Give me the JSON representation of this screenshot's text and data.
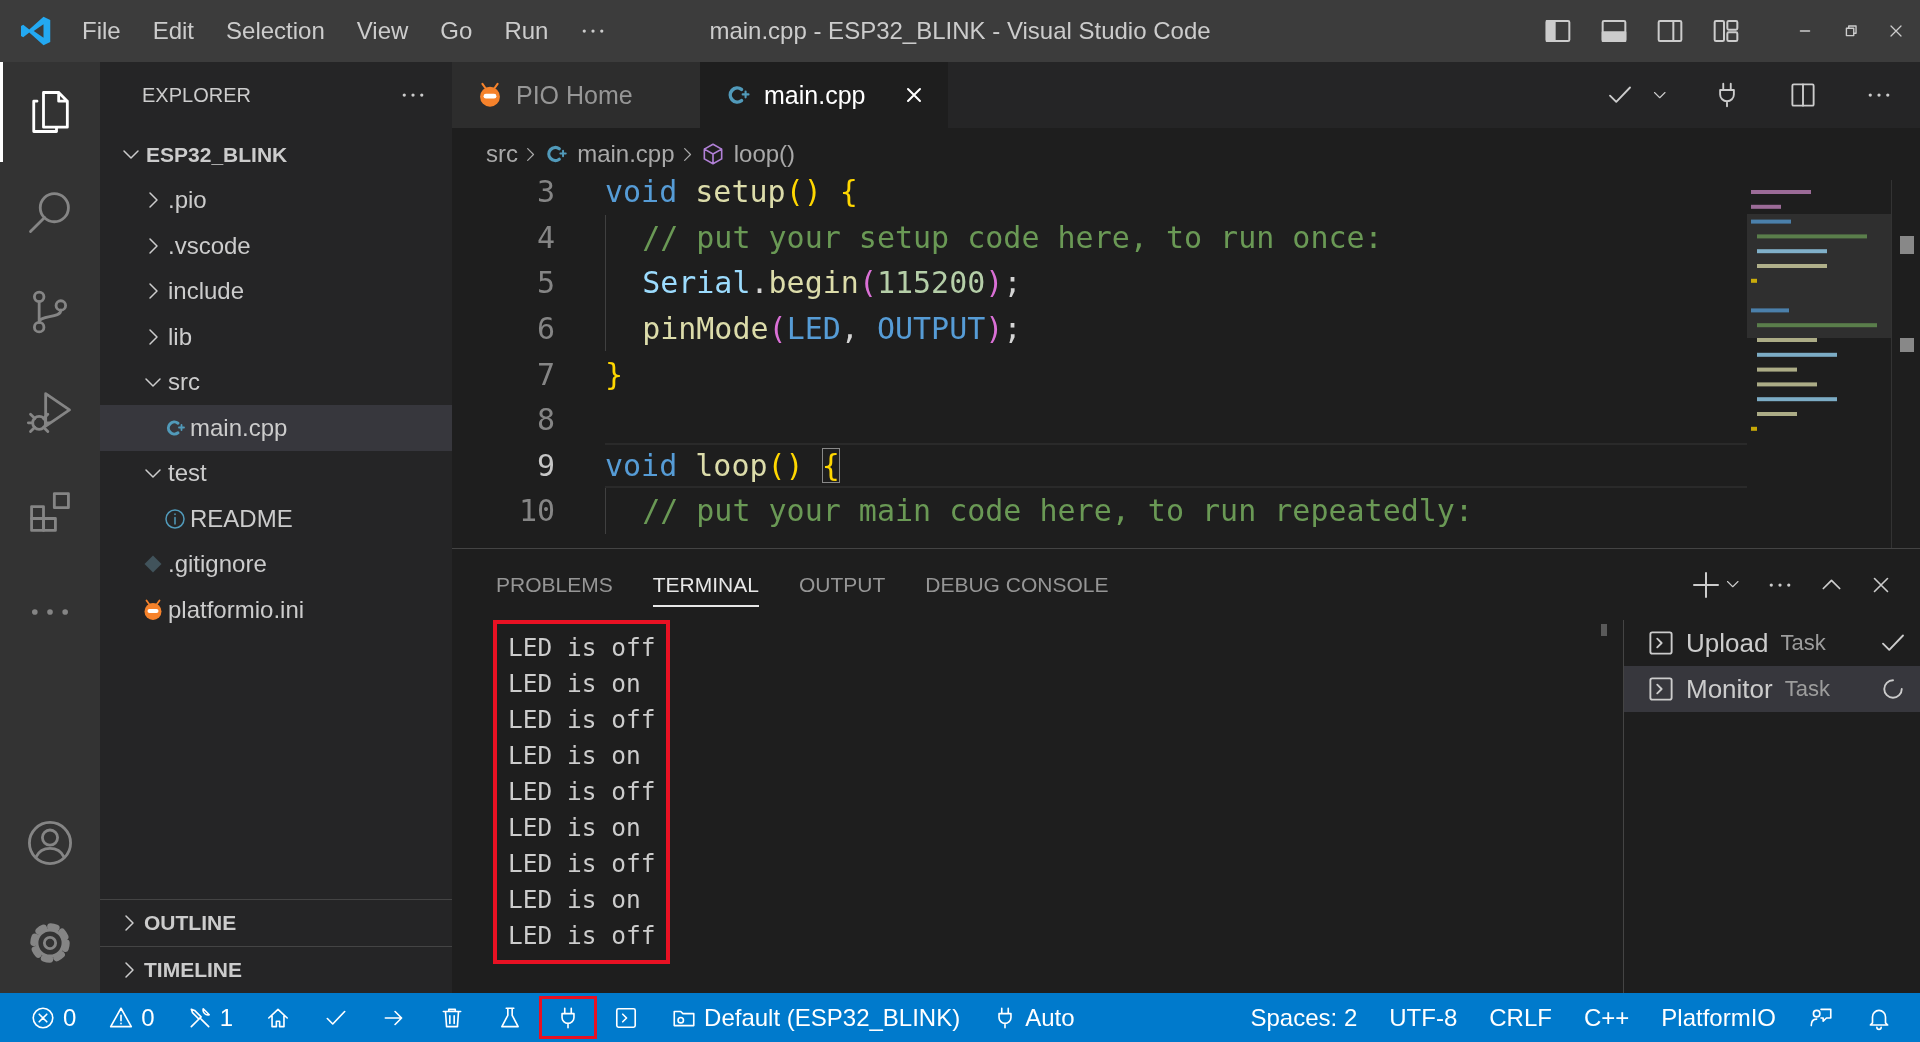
{
  "window": {
    "title": "main.cpp - ESP32_BLINK - Visual Studio Code"
  },
  "menu": [
    "File",
    "Edit",
    "Selection",
    "View",
    "Go",
    "Run"
  ],
  "activity_bar": [
    {
      "kind": "explorer",
      "selected": true
    },
    {
      "kind": "search",
      "selected": false
    },
    {
      "kind": "source-control",
      "selected": false
    },
    {
      "kind": "run-debug",
      "selected": false
    },
    {
      "kind": "extensions",
      "selected": false
    },
    {
      "kind": "more",
      "selected": false
    },
    {
      "kind": "account",
      "selected": false
    },
    {
      "kind": "settings",
      "selected": false
    }
  ],
  "explorer": {
    "title": "EXPLORER",
    "tree": {
      "name": "ESP32_BLINK",
      "kind": "root",
      "expanded": true,
      "selected": false,
      "children": [
        {
          "name": ".pio",
          "kind": "folder",
          "expanded": false,
          "selected": false
        },
        {
          "name": ".vscode",
          "kind": "folder",
          "expanded": false,
          "selected": false
        },
        {
          "name": "include",
          "kind": "folder",
          "expanded": false,
          "selected": false
        },
        {
          "name": "lib",
          "kind": "folder",
          "expanded": false,
          "selected": false
        },
        {
          "name": "src",
          "kind": "folder",
          "expanded": true,
          "selected": false,
          "children": [
            {
              "name": "main.cpp",
              "kind": "cpp",
              "selected": true
            }
          ]
        },
        {
          "name": "test",
          "kind": "folder",
          "expanded": true,
          "selected": false,
          "children": [
            {
              "name": "README",
              "kind": "info",
              "selected": false
            }
          ]
        },
        {
          "name": ".gitignore",
          "kind": "git",
          "selected": false
        },
        {
          "name": "platformio.ini",
          "kind": "pio",
          "selected": false
        }
      ]
    },
    "sections": [
      {
        "title": "OUTLINE",
        "expanded": false
      },
      {
        "title": "TIMELINE",
        "expanded": false
      }
    ]
  },
  "tabs": [
    {
      "label": "PIO Home",
      "kind": "pio",
      "selected": false
    },
    {
      "label": "main.cpp",
      "kind": "cpp",
      "selected": true,
      "closable": true
    }
  ],
  "breadcrumbs": [
    {
      "label": "src",
      "kind": "folder"
    },
    {
      "label": "main.cpp",
      "kind": "cpp"
    },
    {
      "label": "loop()",
      "kind": "method"
    }
  ],
  "editor": {
    "lines": [
      {
        "number": "3",
        "current": false,
        "tokens": [
          {
            "text": "void ",
            "kind": "keyword"
          },
          {
            "text": "setup",
            "kind": "function"
          },
          {
            "text": "() {",
            "kind": "bracket1"
          }
        ]
      },
      {
        "number": "4",
        "current": false,
        "tokens": [
          {
            "text": "  // put your setup code here, to run once:",
            "kind": "comment"
          }
        ]
      },
      {
        "number": "5",
        "current": false,
        "tokens": [
          {
            "text": "  Serial",
            "kind": "variable"
          },
          {
            "text": ".",
            "kind": "plain"
          },
          {
            "text": "begin",
            "kind": "function"
          },
          {
            "text": "(",
            "kind": "bracket2"
          },
          {
            "text": "115200",
            "kind": "number"
          },
          {
            "text": ")",
            "kind": "bracket2"
          },
          {
            "text": ";",
            "kind": "plain"
          }
        ]
      },
      {
        "number": "6",
        "current": false,
        "tokens": [
          {
            "text": "  pinMode",
            "kind": "function"
          },
          {
            "text": "(",
            "kind": "bracket2"
          },
          {
            "text": "LED",
            "kind": "constant"
          },
          {
            "text": ", ",
            "kind": "plain"
          },
          {
            "text": "OUTPUT",
            "kind": "constant"
          },
          {
            "text": ")",
            "kind": "bracket2"
          },
          {
            "text": ";",
            "kind": "plain"
          }
        ]
      },
      {
        "number": "7",
        "current": false,
        "tokens": [
          {
            "text": "}",
            "kind": "bracket1"
          }
        ]
      },
      {
        "number": "8",
        "current": false
      },
      {
        "number": "9",
        "current": true,
        "tokens": [
          {
            "text": "void ",
            "kind": "keyword"
          },
          {
            "text": "loop",
            "kind": "function"
          },
          {
            "text": "() ",
            "kind": "bracket1"
          },
          {
            "text": "{",
            "kind": "bracket1",
            "matched": true
          }
        ]
      },
      {
        "number": "10",
        "current": false,
        "tokens": [
          {
            "text": "  // put your main code here, to run repeatedly:",
            "kind": "comment"
          }
        ]
      }
    ]
  },
  "panel": {
    "tabs": [
      {
        "label": "PROBLEMS",
        "selected": false
      },
      {
        "label": "TERMINAL",
        "selected": true
      },
      {
        "label": "OUTPUT",
        "selected": false
      },
      {
        "label": "DEBUG CONSOLE",
        "selected": false
      }
    ],
    "terminal": {
      "highlighted": true,
      "lines": [
        "LED is off",
        "LED is on",
        "LED is off",
        "LED is on",
        "LED is off",
        "LED is on",
        "LED is off",
        "LED is on",
        "LED is off"
      ]
    },
    "tasks": [
      {
        "name": "Upload",
        "label": "Task",
        "kind": "done",
        "selected": false
      },
      {
        "name": "Monitor",
        "label": "Task",
        "kind": "running",
        "selected": true
      }
    ]
  },
  "status_bar": {
    "left": [
      {
        "kind": "errors",
        "text": "0"
      },
      {
        "kind": "warnings",
        "text": "0"
      },
      {
        "kind": "tools",
        "text": "1"
      },
      {
        "kind": "home"
      },
      {
        "kind": "build"
      },
      {
        "kind": "upload"
      },
      {
        "kind": "clean"
      },
      {
        "kind": "test"
      },
      {
        "kind": "monitor",
        "highlighted": true
      },
      {
        "kind": "terminal"
      },
      {
        "kind": "env",
        "text": "Default (ESP32_BLINK)"
      },
      {
        "kind": "port",
        "text": "Auto"
      }
    ],
    "right": [
      {
        "kind": "indent",
        "text": "Spaces: 2"
      },
      {
        "kind": "encoding",
        "text": "UTF-8"
      },
      {
        "kind": "eol",
        "text": "CRLF"
      },
      {
        "kind": "language",
        "text": "C++"
      },
      {
        "kind": "platform",
        "text": "PlatformIO"
      },
      {
        "kind": "feedback"
      },
      {
        "kind": "bell"
      }
    ]
  }
}
